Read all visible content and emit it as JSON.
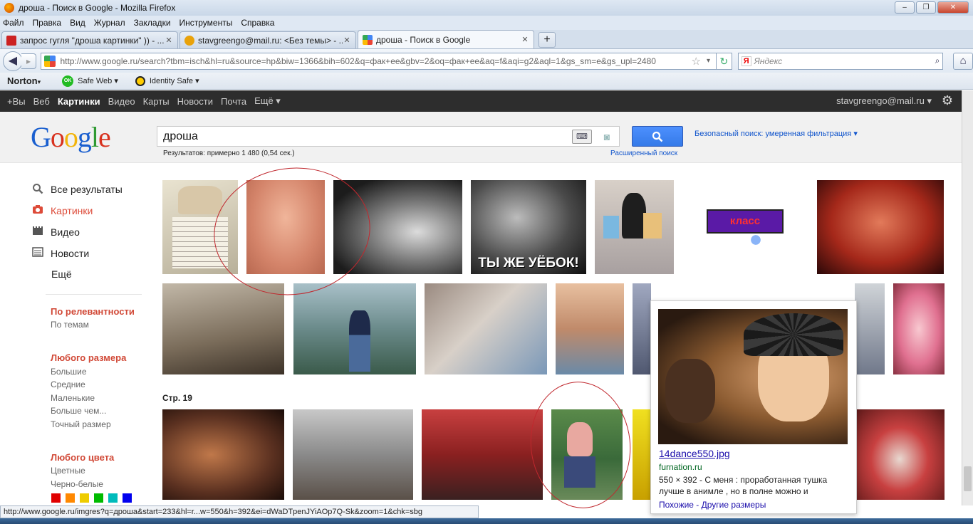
{
  "window": {
    "title": "дроша - Поиск в Google - Mozilla Firefox",
    "controls": [
      "–",
      "❐",
      "✕"
    ]
  },
  "menu": [
    "Файл",
    "Правка",
    "Вид",
    "Журнал",
    "Закладки",
    "Инструменты",
    "Справка"
  ],
  "tabs": [
    {
      "label": "запрос гугля \"дроша картинки\" )) - ...",
      "color": "#c22",
      "close": "✕"
    },
    {
      "label": "stavgreengo@mail.ru: <Без темы> - ...",
      "color": "#e9a20a",
      "close": "✕"
    },
    {
      "label": "дроша - Поиск в Google",
      "color": "#4285f4",
      "close": "✕"
    }
  ],
  "newtab_label": "+",
  "nav": {
    "url": "http://www.google.ru/search?tbm=isch&hl=ru&source=hp&biw=1366&bih=602&q=фак+ee&gbv=2&oq=фак+ee&aq=f&aqi=g2&aql=1&gs_sm=e&gs_upl=2480",
    "search_engine_badge": "Я",
    "search_placeholder": "Яндекс",
    "back_icon": "◀",
    "forward_icon": "▸",
    "star_icon": "☆",
    "dropdown_icon": "▾",
    "reload_icon": "↻",
    "search_icon": "⌕",
    "home_icon": "⌂"
  },
  "norton": {
    "logo": "Norton",
    "safe_web": "Safe Web",
    "safe_web_badge": "OK",
    "identity_safe": "Identity Safe",
    "dropdown": "▾"
  },
  "gbar": {
    "items": [
      "+Вы",
      "Веб",
      "Картинки",
      "Видео",
      "Карты",
      "Новости",
      "Почта",
      "Ещё ▾"
    ],
    "active_index": 2,
    "user": "stavgreengo@mail.ru ▾",
    "gear_icon": "⚙"
  },
  "google": {
    "logo_letters": [
      "G",
      "o",
      "o",
      "g",
      "l",
      "e"
    ],
    "query": "дроша",
    "keyboard_label": "⌨",
    "camera_icon": "◙",
    "search_button_icon": "🔍",
    "safesearch": "Безопасный поиск: умеренная фильтрация ▾",
    "result_stats": "Результатов: примерно 1 480 (0,54 сек.)",
    "advanced_search": "Расширенный поиск"
  },
  "sidebar": {
    "nav": [
      {
        "label": "Все результаты",
        "icon": "🔍"
      },
      {
        "label": "Картинки",
        "icon": "📷"
      },
      {
        "label": "Видео",
        "icon": "▦"
      },
      {
        "label": "Новости",
        "icon": "▤"
      },
      {
        "label": "Ещё",
        "icon": ""
      }
    ],
    "sort_heading": "По релевантности",
    "sort_options": [
      "По темам"
    ],
    "size_heading": "Любого размера",
    "size_options": [
      "Большие",
      "Средние",
      "Маленькие",
      "Больше чем...",
      "Точный размер"
    ],
    "color_heading": "Любого цвета",
    "color_options": [
      "Цветные",
      "Черно-белые"
    ],
    "swatches": [
      "#e00000",
      "#ff8800",
      "#eecc00",
      "#00bb00",
      "#00bbbb",
      "#0000ee"
    ]
  },
  "results": {
    "page_label": "Стр. 19",
    "image_labels": {
      "class_sign": "класс",
      "meme_caption": "ТЫ ЖЕ УЁБОК!"
    }
  },
  "hovercard": {
    "title": "14dance550.jpg",
    "site": "furnation.ru",
    "description": "550 × 392 - С меня : проработанная тушка лучше в анимле , но в полне можно и",
    "links": "Похожие - Другие размеры"
  },
  "statusbar": "http://www.google.ru/imgres?q=дроша&start=233&hl=r...w=550&h=392&ei=dWaDTpenJYiAOp7Q-Sk&zoom=1&chk=sbg"
}
